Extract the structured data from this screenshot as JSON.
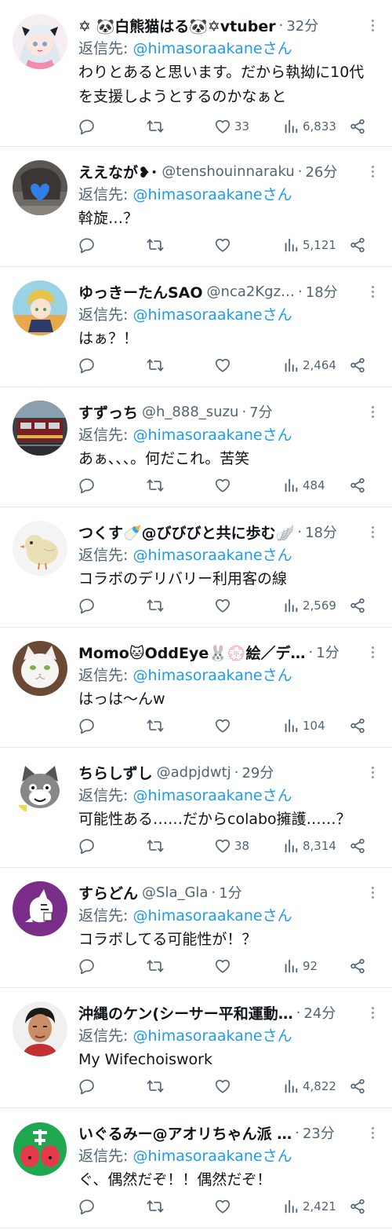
{
  "tweets": [
    {
      "name": "✡ 🐼白熊猫はる🐼✡vtuber",
      "handle": "",
      "time": "32分",
      "reply_prefix": "返信先: ",
      "reply_to": "@himasoraakane",
      "reply_suffix": "さん",
      "text": "わりとあると思います。だから執拗に10代を支援しようとするのかなぁと",
      "likes": "33",
      "views": "6,833",
      "avatar_icon": "anime-girl-avatar"
    },
    {
      "name": "ええなが❥･",
      "handle": "@tenshouinnaraku",
      "time": "26分",
      "reply_prefix": "返信先: ",
      "reply_to": "@himasoraakane",
      "reply_suffix": "さん",
      "text": "斡旋…？",
      "likes": "",
      "views": "5,121",
      "avatar_icon": "blue-heart-photo-avatar"
    },
    {
      "name": "ゆっきーたんSAO",
      "handle": "@nca2Kgz…",
      "time": "18分",
      "reply_prefix": "返信先: ",
      "reply_to": "@himasoraakane",
      "reply_suffix": "さん",
      "text": "はぁ？！",
      "likes": "",
      "views": "2,464",
      "avatar_icon": "anime-boy-avatar"
    },
    {
      "name": "すずっち",
      "handle": "@h_888_suzu",
      "time": "7分",
      "reply_prefix": "返信先: ",
      "reply_to": "@himasoraakane",
      "reply_suffix": "さん",
      "text": "あぁ、、、。何だこれ。苦笑",
      "likes": "",
      "views": "484",
      "avatar_icon": "train-photo-avatar"
    },
    {
      "name": "つくす🍼@びびびと共に歩む🪽",
      "handle": "",
      "time": "18分",
      "reply_prefix": "返信先: ",
      "reply_to": "@himasoraakane",
      "reply_suffix": "さん",
      "text": "コラボのデリバリー利用客の線",
      "likes": "",
      "views": "2,569",
      "avatar_icon": "chick-avatar"
    },
    {
      "name": "Momo🐱OddEye🐰💮絵／デ…",
      "handle": "",
      "time": "1分",
      "reply_prefix": "返信先: ",
      "reply_to": "@himasoraakane",
      "reply_suffix": "さん",
      "text": "はっは〜んw",
      "likes": "",
      "views": "104",
      "avatar_icon": "white-cat-avatar"
    },
    {
      "name": "ちらしずし",
      "handle": "@adpjdwtj",
      "time": "29分",
      "reply_prefix": "返信先: ",
      "reply_to": "@himasoraakane",
      "reply_suffix": "さん",
      "text": "可能性ある……だからcolabo擁護……？",
      "likes": "38",
      "views": "8,314",
      "avatar_icon": "grey-cat-avatar"
    },
    {
      "name": "すらどん",
      "handle": "@Sla_Gla",
      "time": "1分",
      "reply_prefix": "返信先: ",
      "reply_to": "@himasoraakane",
      "reply_suffix": "さん",
      "text": "コラボしてる可能性が！？",
      "likes": "",
      "views": "92",
      "avatar_icon": "purple-creature-avatar"
    },
    {
      "name": "沖縄のケン(シーサー平和運動…",
      "handle": "",
      "time": "24分",
      "reply_prefix": "返信先: ",
      "reply_to": "@himasoraakane",
      "reply_suffix": "さん",
      "text": "My Wifechoiswork",
      "likes": "",
      "views": "4,822",
      "avatar_icon": "man-portrait-avatar"
    },
    {
      "name": "いぐるみー@アオリちゃん派 …",
      "handle": "",
      "time": "23分",
      "reply_prefix": "返信先: ",
      "reply_to": "@himasoraakane",
      "reply_suffix": "さん",
      "text": "ぐ、偶然だぞ！！偶然だぞ！",
      "likes": "",
      "views": "2,421",
      "avatar_icon": "green-red-character-avatar"
    }
  ],
  "colors": {
    "link": "#1d9bf0",
    "muted": "#536471",
    "text": "#0f1419",
    "divider": "#e6e9ec"
  },
  "icons": [
    "reply-icon",
    "retweet-icon",
    "like-icon",
    "views-icon",
    "share-icon",
    "more-icon"
  ]
}
